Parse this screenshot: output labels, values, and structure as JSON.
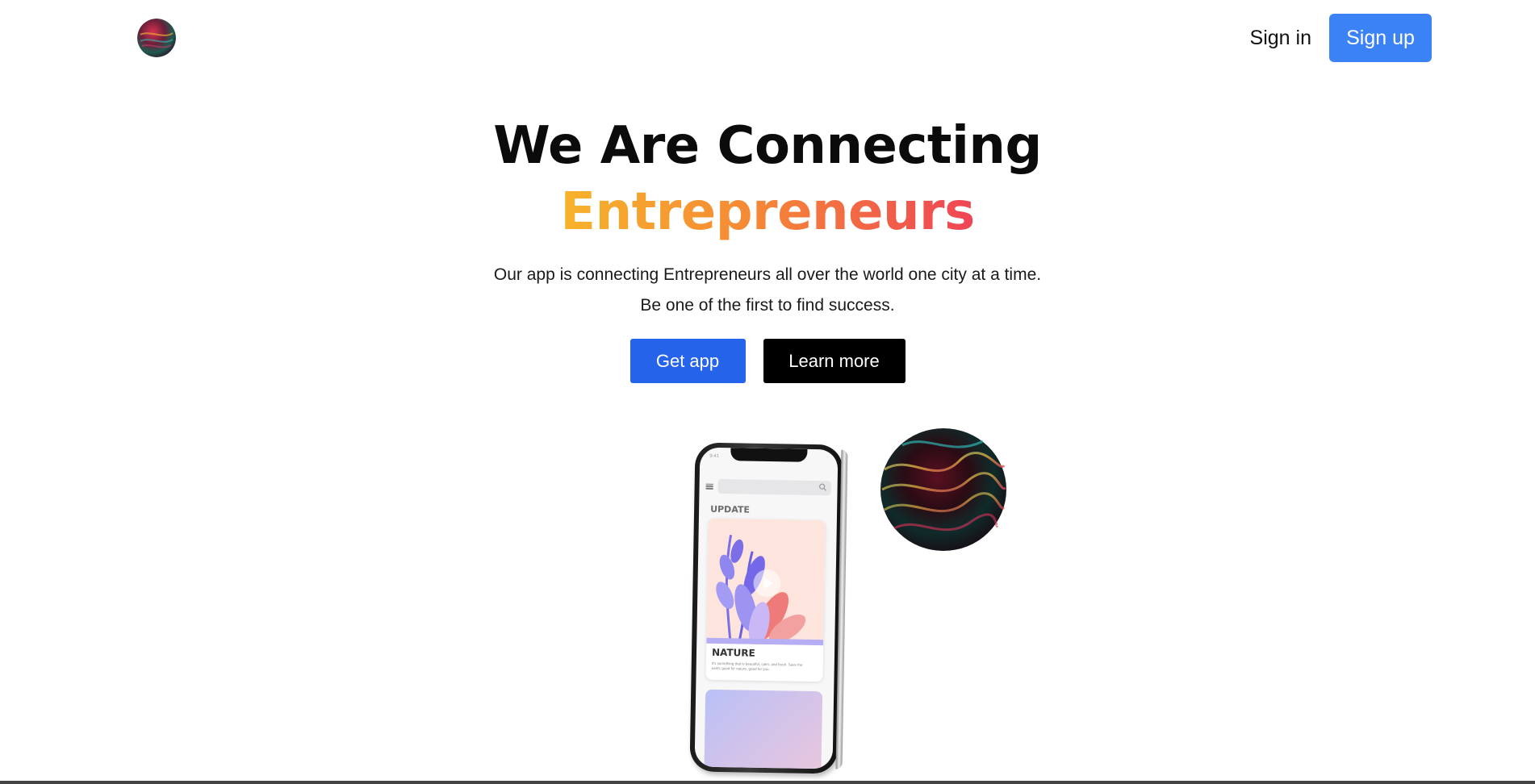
{
  "header": {
    "logo_icon": "gradient-orb-logo-icon",
    "sign_in_label": "Sign in",
    "sign_up_label": "Sign up"
  },
  "hero": {
    "headline": "We Are Connecting",
    "headline_accent": "Entrepreneurs",
    "subtext_line1": "Our app is connecting Entrepreneurs all over the world one city at a time.",
    "subtext_line2": "Be one of the first to find success.",
    "get_app_label": "Get app",
    "learn_more_label": "Learn more"
  },
  "phone_mockup": {
    "status_time": "9:41",
    "section_label": "UPDATE",
    "card_title": "NATURE",
    "card_description": "It's something that is beautiful, calm, and fresh. Save the earth, good for nature, good for you."
  },
  "colors": {
    "signup_blue": "#3b82f6",
    "get_app_blue": "#2563eb",
    "learn_more_black": "#000000",
    "accent_gradient_start": "#f7b32b",
    "accent_gradient_mid": "#f58a35",
    "accent_gradient_end": "#ef4456"
  }
}
